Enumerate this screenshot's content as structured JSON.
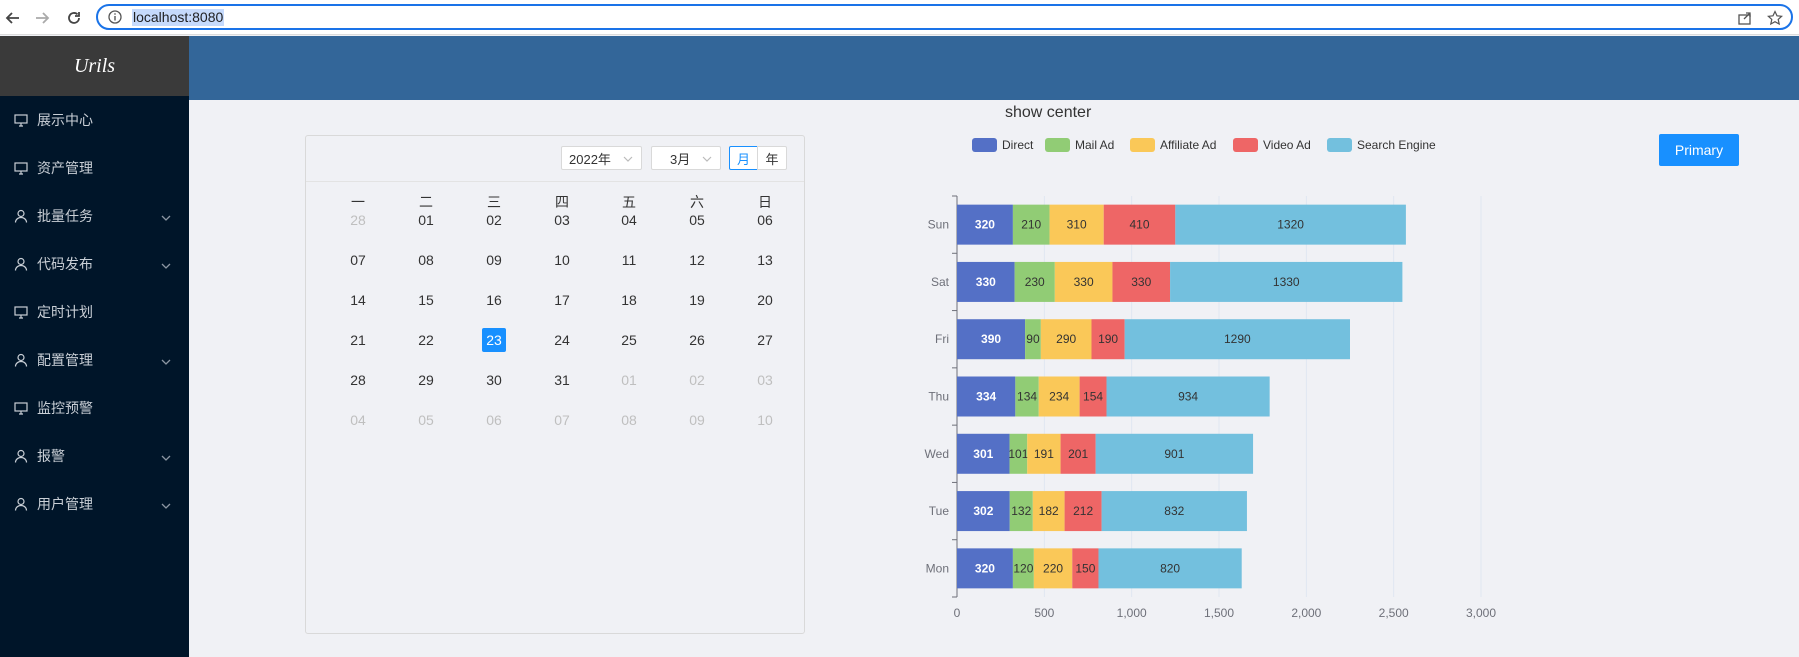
{
  "browser": {
    "url": "localhost:8080"
  },
  "sidebar": {
    "logo": "Urils",
    "items": [
      {
        "label": "展示中心",
        "icon": "monitor-icon",
        "expandable": false
      },
      {
        "label": "资产管理",
        "icon": "monitor-icon",
        "expandable": false
      },
      {
        "label": "批量任务",
        "icon": "user-icon",
        "expandable": true
      },
      {
        "label": "代码发布",
        "icon": "user-icon",
        "expandable": true
      },
      {
        "label": "定时计划",
        "icon": "monitor-icon",
        "expandable": false
      },
      {
        "label": "配置管理",
        "icon": "user-icon",
        "expandable": true
      },
      {
        "label": "监控预警",
        "icon": "monitor-icon",
        "expandable": false
      },
      {
        "label": "报警",
        "icon": "user-icon",
        "expandable": true
      },
      {
        "label": "用户管理",
        "icon": "user-icon",
        "expandable": true
      }
    ]
  },
  "calendar": {
    "year_select": "2022年",
    "month_select": "3月",
    "mode_month": "月",
    "mode_year": "年",
    "weekdays": [
      "一",
      "二",
      "三",
      "四",
      "五",
      "六",
      "日"
    ],
    "weeks": [
      [
        "28",
        "01",
        "02",
        "03",
        "04",
        "05",
        "06"
      ],
      [
        "07",
        "08",
        "09",
        "10",
        "11",
        "12",
        "13"
      ],
      [
        "14",
        "15",
        "16",
        "17",
        "18",
        "19",
        "20"
      ],
      [
        "21",
        "22",
        "23",
        "24",
        "25",
        "26",
        "27"
      ],
      [
        "28",
        "29",
        "30",
        "31",
        "01",
        "02",
        "03"
      ],
      [
        "04",
        "05",
        "06",
        "07",
        "08",
        "09",
        "10"
      ]
    ],
    "selected_day": "23"
  },
  "primary_button": "Primary",
  "colors": {
    "sidebar_bg": "#001529",
    "header_bg": "#336699",
    "accent": "#1890ff"
  },
  "chart_data": {
    "type": "bar",
    "orientation": "horizontal",
    "stacked": true,
    "title": "show center",
    "categories": [
      "Mon",
      "Tue",
      "Wed",
      "Thu",
      "Fri",
      "Sat",
      "Sun"
    ],
    "series": [
      {
        "name": "Direct",
        "color": "#5470c6",
        "values": [
          320,
          302,
          301,
          334,
          390,
          330,
          320
        ]
      },
      {
        "name": "Mail Ad",
        "color": "#91cc75",
        "values": [
          120,
          132,
          101,
          134,
          90,
          230,
          210
        ]
      },
      {
        "name": "Affiliate Ad",
        "color": "#fac858",
        "values": [
          220,
          182,
          191,
          234,
          290,
          330,
          310
        ]
      },
      {
        "name": "Video Ad",
        "color": "#ee6666",
        "values": [
          150,
          212,
          201,
          154,
          190,
          330,
          410
        ]
      },
      {
        "name": "Search Engine",
        "color": "#73c0de",
        "values": [
          820,
          832,
          901,
          934,
          1290,
          1330,
          1320
        ]
      }
    ],
    "xlim": [
      0,
      3000
    ],
    "xticks": [
      "0",
      "500",
      "1,000",
      "1,500",
      "2,000",
      "2,500",
      "3,000"
    ],
    "legend_position": "top-center",
    "grid": true
  }
}
